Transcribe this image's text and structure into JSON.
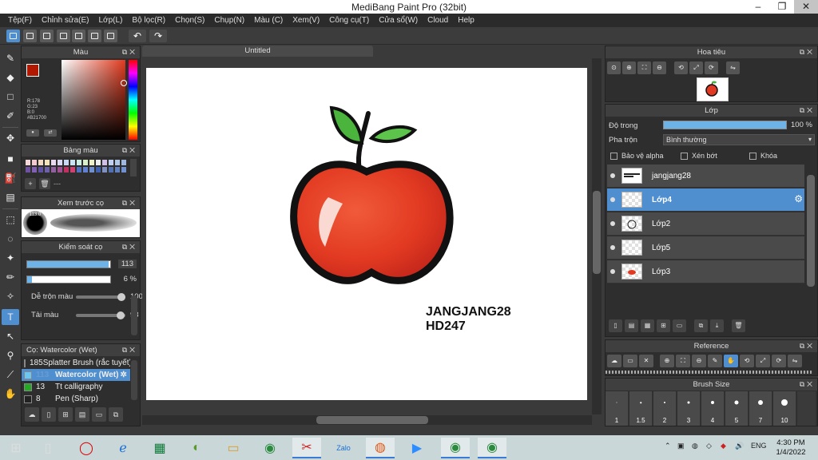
{
  "window": {
    "title": "MediBang Paint Pro (32bit)"
  },
  "menu": [
    "Tệp(F)",
    "Chỉnh sửa(E)",
    "Lớp(L)",
    "Bộ lọc(R)",
    "Chọn(S)",
    "Chụp(N)",
    "Màu (C)",
    "Xem(V)",
    "Công cụ(T)",
    "Cửa sổ(W)",
    "Cloud",
    "Help"
  ],
  "toolbar": {
    "undo_label": "↶",
    "redo_label": "↷"
  },
  "color_panel": {
    "title": "Màu",
    "fg_color": "#B21700",
    "readout": [
      "R:178",
      "G:23",
      "B:0",
      "#B21700"
    ]
  },
  "palette_panel": {
    "title": "Bảng màu",
    "footer_text": "---",
    "colors": [
      "#f6d7d7",
      "#f3c9d0",
      "#f2d9c2",
      "#f4e3bb",
      "#e8d9f0",
      "#d9d9f3",
      "#c9d9f3",
      "#c9e3f3",
      "#c9f0e3",
      "#d9f0c9",
      "#f0f0c9",
      "#eeeeee",
      "#d0c0e8",
      "#c0d0f0",
      "#b0c8e8",
      "#a0b8e0",
      "#7050a0",
      "#8060b0",
      "#6050a0",
      "#7060a8",
      "#9060a0",
      "#a05090",
      "#c03060",
      "#d04070",
      "#5070c0",
      "#6080d0",
      "#7090d0",
      "#4060b0",
      "#8090c0",
      "#5070b0",
      "#6080c0",
      "#7090d0"
    ]
  },
  "brush_preview": {
    "title": "Xem trước cọ",
    "size_label": "113.0"
  },
  "control_panel": {
    "title": "Kiểm soát cọ",
    "size_value": "113",
    "size_fill": 0.98,
    "opacity_value": "6 %",
    "opacity_fill": 0.06,
    "blend_label": "Dễ trộn màu",
    "blend_value": "100",
    "blend_fill": 1.0,
    "amount_label": "Tải màu",
    "amount_value": "98",
    "amount_fill": 0.98
  },
  "brush_list": {
    "title": "Cọ: Watercolor (Wet)",
    "items": [
      {
        "size": "185",
        "name": "Splatter Brush (rắc tuyết)",
        "color": "#3a5ad0"
      },
      {
        "size": "113",
        "name": "Watercolor (Wet)",
        "color": "#6cc6f0"
      },
      {
        "size": "13",
        "name": "Tt calligraphy",
        "color": "#22aa22"
      },
      {
        "size": "8",
        "name": "Pen (Sharp)",
        "color": "#222222"
      }
    ]
  },
  "canvas": {
    "tab_label": "Untitled",
    "signature_line1": "JANGJANG28",
    "signature_line2": "HD247"
  },
  "navigator": {
    "title": "Hoa tiêu"
  },
  "layer_panel": {
    "title": "Lớp",
    "opacity_label": "Độ trong",
    "opacity_value": "100 %",
    "blend_label": "Pha trộn",
    "blend_value": "Bình thường",
    "protect_alpha": "Bảo vệ alpha",
    "clipping": "Xén bớt",
    "lock": "Khóa",
    "layers": [
      {
        "name": "jangjang28",
        "selected": false
      },
      {
        "name": "Lớp4",
        "selected": true
      },
      {
        "name": "Lớp2",
        "selected": false
      },
      {
        "name": "Lớp5",
        "selected": false
      },
      {
        "name": "Lớp3",
        "selected": false
      }
    ]
  },
  "reference": {
    "title": "Reference"
  },
  "brush_size": {
    "title": "Brush Size",
    "sizes": [
      "1",
      "1.5",
      "2",
      "3",
      "4",
      "5",
      "7",
      "10"
    ]
  },
  "taskbar": {
    "lang": "ENG",
    "time": "4:30 PM",
    "date": "1/4/2022",
    "zalo_label": "Zalo"
  }
}
